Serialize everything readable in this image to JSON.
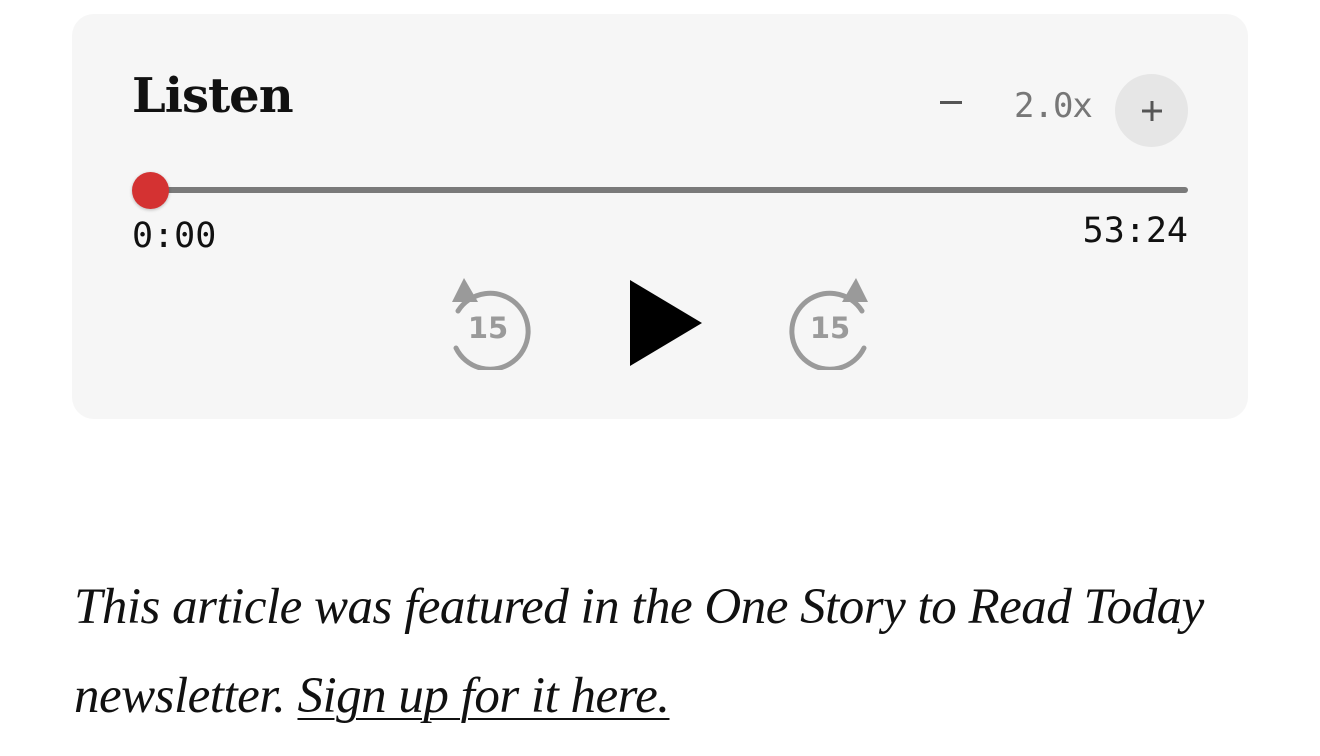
{
  "player": {
    "title": "Listen",
    "speed": "2.0x",
    "speed_decrease_symbol": "–",
    "speed_increase_symbol": "+",
    "current_time": "0:00",
    "total_time": "53:24",
    "progress_fraction": 0,
    "skip_back_seconds": "15",
    "skip_forward_seconds": "15",
    "accent_color": "#d43232"
  },
  "note": {
    "text": "This article was featured in the One Story to Read Today newsletter. ",
    "link_text": "Sign up for it here."
  },
  "icons": {
    "skip_back": "rewind-15-icon",
    "play": "play-icon",
    "skip_forward": "forward-15-icon",
    "decrease": "minus-icon",
    "increase": "plus-icon"
  }
}
